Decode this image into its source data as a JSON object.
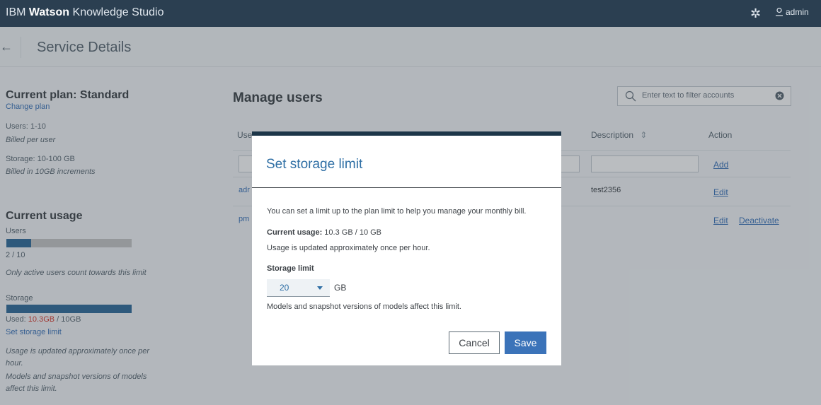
{
  "topbar": {
    "brand_prefix": "IBM ",
    "brand_bold": "Watson",
    "brand_suffix": " Knowledge Studio",
    "user": "admin"
  },
  "page": {
    "title": "Service Details"
  },
  "sidebar": {
    "plan_title": "Current plan: Standard",
    "change_plan": "Change plan",
    "users_range": "Users: 1-10",
    "billed_per_user": "Billed per user",
    "storage_range": "Storage: 10-100 GB",
    "billed_increments": "Billed in 10GB increments",
    "usage_title": "Current usage",
    "users_label": "Users",
    "users_count": "2 / 10",
    "users_progress": 0.2,
    "active_note": "Only active users count towards this limit",
    "storage_label": "Storage",
    "storage_progress": 1.0,
    "used_prefix": "Used: ",
    "used_value": "10.3GB",
    "used_suffix": " / 10GB",
    "set_storage_link": "Set storage limit",
    "update_note_1": "Usage is updated approximately once per",
    "update_note_2": "hour.",
    "models_note_1": "Models and snapshot versions of models",
    "models_note_2": "affect this limit."
  },
  "main": {
    "title": "Manage users",
    "filter_placeholder": "Enter text to filter accounts",
    "columns": {
      "user": "Use",
      "description": "Description",
      "action": "Action"
    },
    "add_link": "Add",
    "rows": [
      {
        "user": "adr",
        "description": "test2356",
        "edit": "Edit"
      },
      {
        "user": "pm",
        "description": "",
        "edit": "Edit",
        "deactivate": "Deactivate"
      }
    ]
  },
  "modal": {
    "title": "Set storage limit",
    "intro": "You can set a limit up to the plan limit to help you manage your monthly bill.",
    "usage_label": "Current usage:",
    "usage_value": " 10.3 GB / 10 GB",
    "update_note": "Usage is updated approximately once per hour.",
    "limit_label": "Storage limit",
    "limit_value": "20",
    "unit": "GB",
    "models_note": "Models and snapshot versions of models affect this limit.",
    "cancel": "Cancel",
    "save": "Save"
  },
  "colors": {
    "topbar": "#2b3f51",
    "link": "#3b73b9",
    "primary_button": "#3b73b9",
    "progress_fill": "#2f6a9a",
    "used_highlight": "#d83a2e"
  }
}
